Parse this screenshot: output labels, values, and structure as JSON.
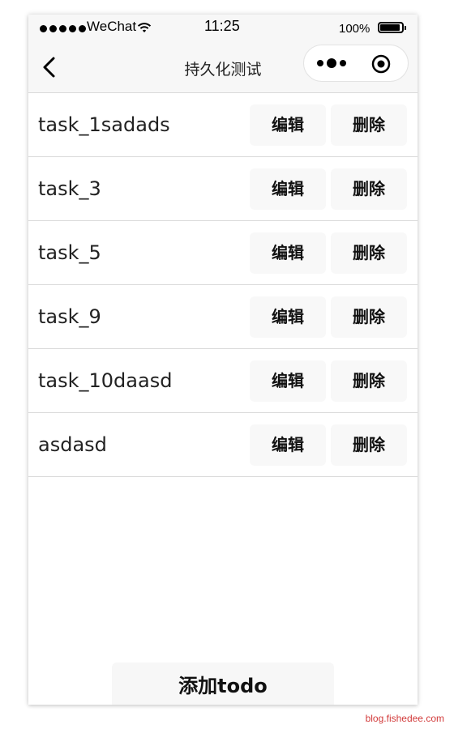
{
  "status_bar": {
    "carrier": "WeChat",
    "time": "11:25",
    "battery_percent": "100%",
    "battery_level": 1.0,
    "signal_dots": 5,
    "wifi_icon": "wifi-icon"
  },
  "nav": {
    "title": "持久化测试",
    "back_icon": "chevron-left-icon",
    "capsule_more_icon": "more-dots-icon",
    "capsule_close_icon": "target-close-icon"
  },
  "todos": [
    {
      "text": "task_1sadads",
      "edit_label": "编辑",
      "delete_label": "删除"
    },
    {
      "text": "task_3",
      "edit_label": "编辑",
      "delete_label": "删除"
    },
    {
      "text": "task_5",
      "edit_label": "编辑",
      "delete_label": "删除"
    },
    {
      "text": "task_9",
      "edit_label": "编辑",
      "delete_label": "删除"
    },
    {
      "text": "task_10daasd",
      "edit_label": "编辑",
      "delete_label": "删除"
    },
    {
      "text": "asdasd",
      "edit_label": "编辑",
      "delete_label": "删除"
    }
  ],
  "footer": {
    "add_label": "添加todo"
  },
  "watermark": "blog.fishedee.com",
  "colors": {
    "watermark": "#d23b3b",
    "bar_background": "#f7f7f7",
    "button_background": "#f8f8f8"
  }
}
